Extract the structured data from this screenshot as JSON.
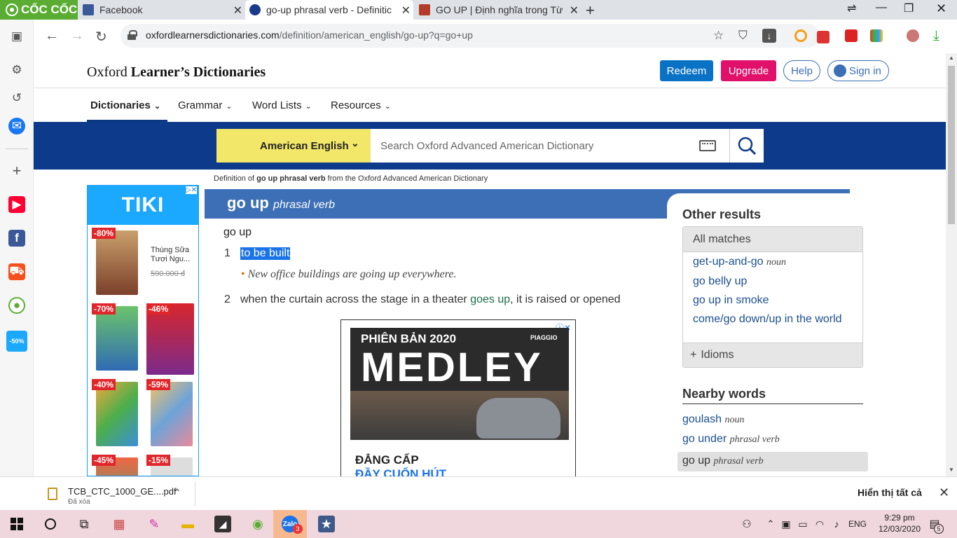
{
  "browser": {
    "brand": "CỐC CỐC",
    "tabs": [
      {
        "label": "Facebook"
      },
      {
        "label": "go-up phrasal verb - Definitic"
      },
      {
        "label": "GO UP | Định nghĩa trong Từ"
      }
    ],
    "url_host": "oxfordlearnersdictionaries.com",
    "url_path": "/definition/american_english/go-up?q=go+up"
  },
  "header": {
    "logo_plain": "Oxford",
    "logo_bold": "Learner’s Dictionaries",
    "redeem": "Redeem",
    "upgrade": "Upgrade",
    "help": "Help",
    "signin": "Sign in"
  },
  "nav": {
    "items": [
      "Dictionaries",
      "Grammar",
      "Word Lists",
      "Resources"
    ]
  },
  "search": {
    "dictionary": "American English",
    "placeholder": "Search Oxford Advanced American Dictionary"
  },
  "breadcrumb": {
    "prefix": "Definition of ",
    "term": "go up phrasal verb",
    "suffix": " from the Oxford Advanced American Dictionary"
  },
  "entry": {
    "headword": "go up",
    "pos": "phrasal verb",
    "phrase": "go up",
    "senses": [
      {
        "num": "1",
        "def": "to be built",
        "example": "New office buildings are going up everywhere."
      },
      {
        "num": "2",
        "def_before": "when the curtain across the stage in a theater ",
        "def_link": "goes up",
        "def_after": ", it is raised or opened"
      }
    ]
  },
  "ad_left": {
    "brand": "TIKI",
    "badges": [
      "-80%",
      "-70%",
      "-46%",
      "-40%",
      "-59%",
      "-45%",
      "-15%"
    ],
    "cell_title": "Thùng Sữa Tươi Ngu...",
    "cell_price": "590.000 đ"
  },
  "ad_center": {
    "line1": "PHIÊN BẢN 2020",
    "line2": "MEDLEY",
    "brand": "PIAGGIO",
    "foot1": "ĐẲNG CẤP",
    "foot2": "ĐẦY CUỐN HÚT"
  },
  "other_results": {
    "title": "Other results",
    "all_matches": "All matches",
    "items": [
      {
        "word": "get-up-and-go",
        "pos": "noun"
      },
      {
        "word": "go belly up",
        "pos": ""
      },
      {
        "word": "go up in smoke",
        "pos": ""
      },
      {
        "word": "come/go down/up in the world",
        "pos": ""
      }
    ],
    "idioms": "Idioms"
  },
  "nearby": {
    "title": "Nearby words",
    "items": [
      {
        "word": "goulash",
        "pos": "noun"
      },
      {
        "word": "go under",
        "pos": "phrasal verb"
      },
      {
        "word": "go up",
        "pos": "phrasal verb"
      }
    ]
  },
  "downloads": {
    "file": "TCB_CTC_1000_GE....pdf",
    "status": "Đã xóa",
    "show_all": "Hiển thị tất cả"
  },
  "taskbar": {
    "lang": "ENG",
    "time": "9:29 pm",
    "date": "12/03/2020",
    "zalo_count": "3",
    "notif_count": "5"
  },
  "colors": {
    "oxford_blue": "#0d3a8a",
    "entry_blue": "#3c6fb5",
    "redeem": "#0a72c4",
    "upgrade": "#e0106b",
    "dict_yellow": "#f2e769",
    "coccoc_green": "#5aad32"
  }
}
